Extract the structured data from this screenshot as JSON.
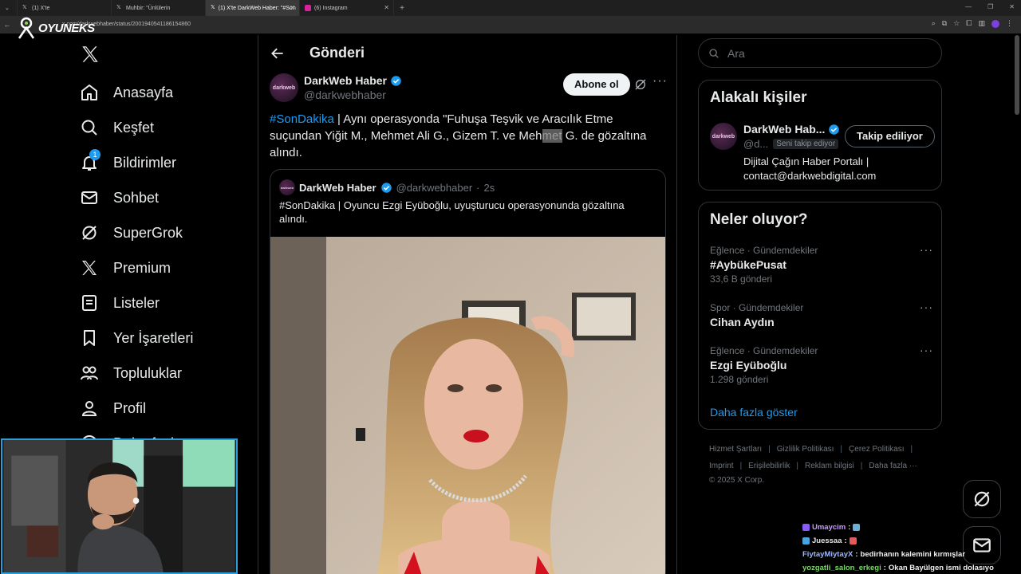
{
  "browser": {
    "tabs": [
      {
        "label": "(1) X'te",
        "icon": "x-icon"
      },
      {
        "label": "Muhbir: \"Ünlülerin",
        "icon": "x-icon"
      },
      {
        "label": "(1) X'te DarkWeb Haber: \"#Son",
        "icon": "x-icon",
        "active": true
      },
      {
        "label": "(6) Instagram",
        "icon": "instagram-icon"
      }
    ],
    "url": "x.com/darkwebhaber/status/2001940541186154860"
  },
  "overlay_logo": "OYUNEKS",
  "nav": {
    "items": [
      {
        "label": "Anasayfa",
        "icon": "home-icon"
      },
      {
        "label": "Keşfet",
        "icon": "search-icon"
      },
      {
        "label": "Bildirimler",
        "icon": "bell-icon",
        "badge": "1"
      },
      {
        "label": "Sohbet",
        "icon": "mail-icon"
      },
      {
        "label": "SuperGrok",
        "icon": "grok-icon"
      },
      {
        "label": "Premium",
        "icon": "x-icon"
      },
      {
        "label": "Listeler",
        "icon": "list-icon"
      },
      {
        "label": "Yer İşaretleri",
        "icon": "bookmark-icon"
      },
      {
        "label": "Topluluklar",
        "icon": "communities-icon"
      },
      {
        "label": "Profil",
        "icon": "profile-icon"
      },
      {
        "label": "Daha fazla",
        "icon": "more-icon"
      }
    ]
  },
  "post": {
    "header": "Gönderi",
    "author_name": "DarkWeb Haber",
    "author_handle": "@darkwebhaber",
    "avatar_text": "darkweb",
    "subscribe": "Abone ol",
    "text_hashtag": "#SonDakika",
    "text_part1": " | Aynı operasyonda \"Fuhuşa Teşvik ve Aracılık Etme suçundan Yiğit M., Mehmet Ali G., Gizem T. ve Meh",
    "text_highlight": "met",
    "text_part2": " G. de gözaltına alındı.",
    "quote": {
      "author_name": "DarkWeb Haber",
      "author_handle": "@darkwebhaber",
      "separator": "·",
      "time": "2s",
      "text": "#SonDakika | Oyuncu Ezgi Eyüboğlu, uyuşturucu operasyonunda gözaltına alındı."
    }
  },
  "sidebar": {
    "search_placeholder": "Ara",
    "related_title": "Alakalı kişiler",
    "related": {
      "name": "DarkWeb Hab...",
      "handle": "@d...",
      "follows_you": "Seni takip ediyor",
      "button": "Takip ediliyor",
      "bio_line1": "Dijital Çağın Haber Portalı |",
      "bio_line2": "contact@darkwebdigital.com"
    },
    "trends_title": "Neler oluyor?",
    "trends": [
      {
        "category": "Eğlence · Gündemdekiler",
        "name": "#AybükePusat",
        "count": "33,6 B gönderi"
      },
      {
        "category": "Spor · Gündemdekiler",
        "name": "Cihan Aydın",
        "count": ""
      },
      {
        "category": "Eğlence · Gündemdekiler",
        "name": "Ezgi Eyüboğlu",
        "count": "1.298 gönderi"
      }
    ],
    "show_more": "Daha fazla göster",
    "footer_row1": [
      "Hizmet Şartları",
      "Gizlilik Politikası",
      "Çerez Politikası"
    ],
    "footer_row2": [
      "Imprint",
      "Erişilebilirlik",
      "Reklam bilgisi",
      "Daha fazla ···"
    ],
    "copyright": "© 2025 X Corp."
  },
  "chat": [
    {
      "user": "Umaycim",
      "msg": ""
    },
    {
      "user": "Juessaa",
      "msg": ""
    },
    {
      "user": "FiytayMiytayX",
      "msg": "bedirhanın kalemini kırmışlar"
    },
    {
      "user": "yozgatli_salon_erkegi",
      "msg": "Okan Bayülgen ismi dolasıyo"
    }
  ],
  "colors": {
    "accent": "#1d9bf0",
    "background": "#000000",
    "border": "#2f3336",
    "muted": "#71767b"
  }
}
